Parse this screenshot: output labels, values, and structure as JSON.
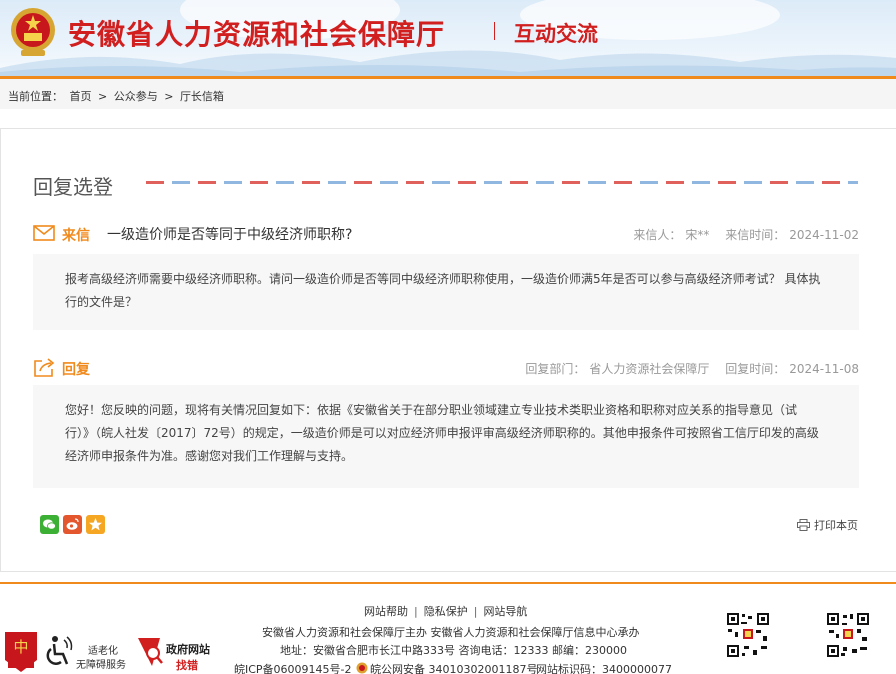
{
  "header": {
    "site_title": "安徽省人力资源和社会保障厅",
    "section_title": "互动交流"
  },
  "breadcrumb": {
    "prefix": "当前位置：",
    "items": [
      "首页",
      "公众参与",
      "厅长信箱"
    ],
    "separator": ">"
  },
  "card": {
    "title": "回复选登",
    "letter": {
      "tag": "来信",
      "subject": "一级造价师是否等同于中级经济师职称?",
      "sender_label": "来信人：",
      "sender": "宋**",
      "date_label": "来信时间：",
      "date": "2024-11-02",
      "body": "报考高级经济师需要中级经济师职称。请问一级造价师是否等同中级经济师职称使用，一级造价师满5年是否可以参与高级经济师考试？ 具体执行的文件是？"
    },
    "reply": {
      "tag": "回复",
      "dept_label": "回复部门：",
      "dept": "省人力资源社会保障厅",
      "date_label": "回复时间：",
      "date": "2024-11-08",
      "body": "您好！您反映的问题，现将有关情况回复如下：依据《安徽省关于在部分职业领域建立专业技术类职业资格和职称对应关系的指导意见（试行）》（皖人社发〔2017〕72号）的规定，一级造价师是可以对应经济师申报评审高级经济师职称的。其他申报条件可按照省工信厅印发的高级经济师申报条件为准。感谢您对我们工作理解与支持。"
    },
    "share_icons": [
      "wechat-icon",
      "weibo-icon",
      "favorite-icon"
    ],
    "print_label": "打印本页"
  },
  "footer": {
    "links": [
      "网站帮助",
      "隐私保护",
      "网站导航"
    ],
    "line1": "安徽省人力资源和社会保障厅主办  安徽省人力资源和社会保障厅信息中心承办",
    "line2": "地址：安徽省合肥市长江中路333号  咨询电话：12333  邮编：230000",
    "icp": "皖ICP备06009145号-2",
    "police": "皖公网安备 34010302001187号",
    "site_id": "网站标识码：3400000077",
    "accessibility_1": "适老化",
    "accessibility_2": "无障碍服务",
    "gov_site_1": "政府网站",
    "gov_site_2": "找错"
  },
  "colors": {
    "brand_red": "#d11f1f",
    "accent_orange": "#f08a1c"
  }
}
